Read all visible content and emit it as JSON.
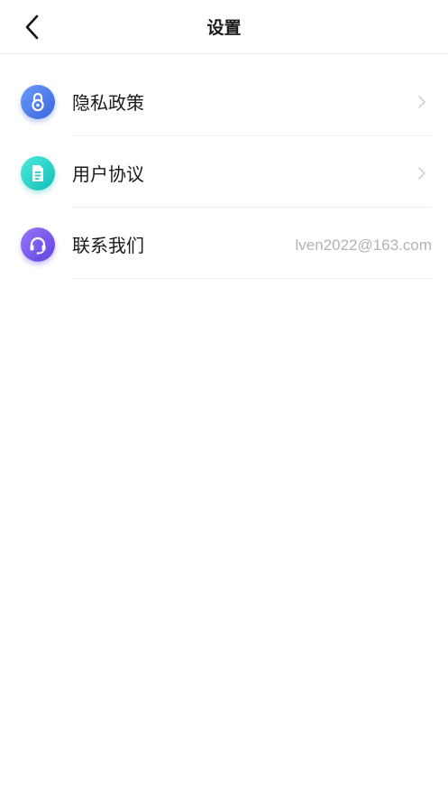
{
  "header": {
    "title": "设置",
    "back_icon": "chevron-left-icon"
  },
  "settings": {
    "items": [
      {
        "label": "隐私政策",
        "icon": "privacy-lock-icon",
        "icon_colors": [
          "#5B8DF6",
          "#3A63E0"
        ],
        "has_chevron": true
      },
      {
        "label": "用户协议",
        "icon": "document-icon",
        "icon_colors": [
          "#3FE3D3",
          "#16C2BC"
        ],
        "has_chevron": true
      },
      {
        "label": "联系我们",
        "icon": "headset-icon",
        "icon_colors": [
          "#8B6BF3",
          "#6544E3"
        ],
        "value": "lven2022@163.com",
        "has_chevron": false
      }
    ]
  }
}
